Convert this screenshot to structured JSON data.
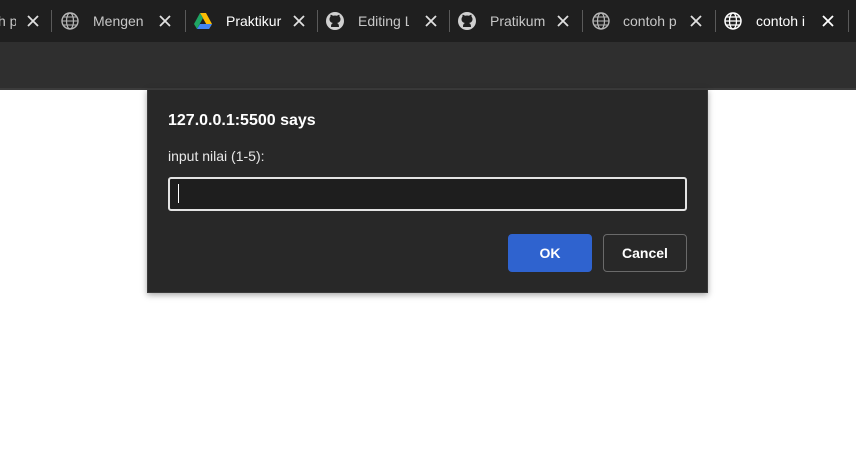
{
  "browser": {
    "tabs": [
      {
        "title": "h p",
        "icon": "globe-icon",
        "active": false
      },
      {
        "title": "Mengen",
        "icon": "globe-icon",
        "active": false
      },
      {
        "title": "Praktikur",
        "icon": "google-drive-icon",
        "active": false
      },
      {
        "title": "Editing L",
        "icon": "github-icon",
        "active": false
      },
      {
        "title": "Pratikum",
        "icon": "github-icon",
        "active": false
      },
      {
        "title": "contoh p",
        "icon": "globe-icon",
        "active": false
      },
      {
        "title": "contoh i",
        "icon": "globe-icon",
        "active": true
      }
    ],
    "colors": {
      "tabstrip": "#1f1f1f",
      "toolbar": "#2f2f2f"
    }
  },
  "dialog": {
    "title": "127.0.0.1:5500 says",
    "message": "input nilai (1-5):",
    "input_value": "",
    "ok_label": "OK",
    "cancel_label": "Cancel",
    "colors": {
      "background": "#282828",
      "ok_button": "#2f63cf"
    }
  }
}
